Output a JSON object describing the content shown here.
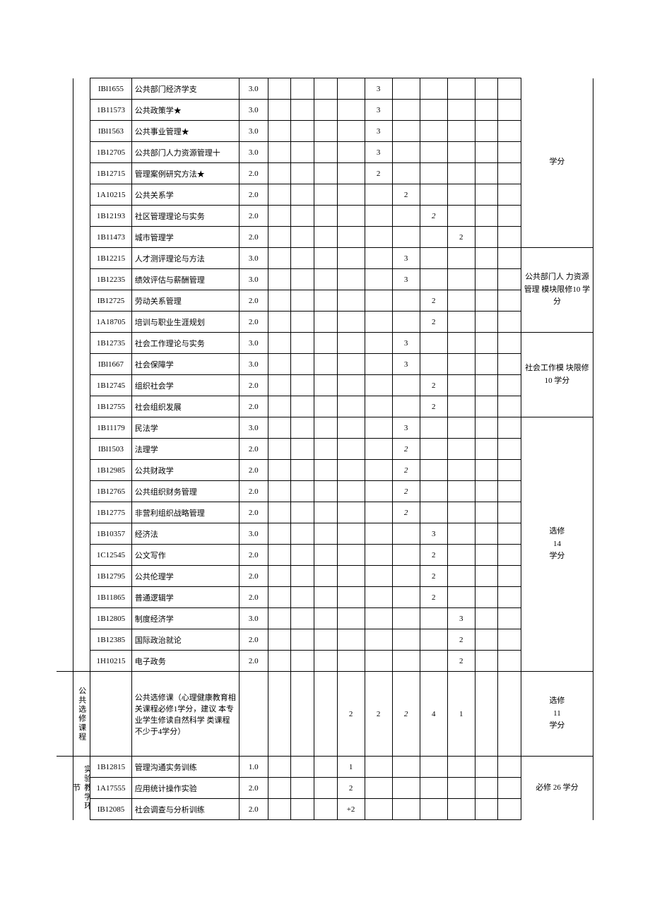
{
  "categories": {
    "public_elective": "公共选修课程",
    "experiment": "实验教学环节"
  },
  "notes_groups": {
    "g1": "学分",
    "g2": "公共部门人 力资源管理 模块限修10 学分",
    "g3": "社会工作模 块限修10 学分",
    "g4": "选修\n14\n学分",
    "g5": "选修\n11\n学分",
    "g6": "必修 26 学分"
  },
  "public_elective_note": "公共选修课（心理健康教育相关课程必修1学分，建议 本专业学生修读自然科学 类课程不少于4学分）",
  "rows": [
    {
      "code": "IBl1655",
      "name": "公共部门经济学支",
      "credit": "3.0",
      "s": {
        "5": "3"
      }
    },
    {
      "code": "1B11573",
      "name": "公共政策学★",
      "credit": "3.0",
      "s": {
        "5": "3"
      }
    },
    {
      "code": "IBl1563",
      "name": "公共事业管理★",
      "credit": "3.0",
      "s": {
        "5": "3"
      }
    },
    {
      "code": "1B12705",
      "name": "公共部门人力资源管理十",
      "credit": "3.0",
      "s": {
        "5": "3"
      }
    },
    {
      "code": "1B12715",
      "name": "管理案例研究方法★",
      "credit": "2.0",
      "s": {
        "5": "2"
      }
    },
    {
      "code": "1A10215",
      "name": "公共关系学",
      "credit": "2.0",
      "s": {
        "6": "2"
      }
    },
    {
      "code": "1B12193",
      "name": "社区管理理论与实务",
      "credit": "2.0",
      "s": {
        "7": "2",
        "7_italic": true
      }
    },
    {
      "code": "1B11473",
      "name": "城市管理学",
      "credit": "2.0",
      "s": {
        "8": "2"
      }
    },
    {
      "code": "1B12215",
      "name": "人才测评理论与方法",
      "credit": "3.0",
      "s": {
        "6": "3"
      }
    },
    {
      "code": "1B12235",
      "name": "绩效评估与薪酬管理",
      "credit": "3.0",
      "s": {
        "6": "3"
      }
    },
    {
      "code": "IB12725",
      "name": "劳动关系管理",
      "credit": "2.0",
      "s": {
        "7": "2"
      }
    },
    {
      "code": "1A18705",
      "name": "培训与职业生涯规划",
      "credit": "2.0",
      "s": {
        "7": "2"
      }
    },
    {
      "code": "1B12735",
      "name": "社会工作理论与实务",
      "credit": "3.0",
      "s": {
        "6": "3"
      }
    },
    {
      "code": "IBl1667",
      "name": "社会保障学",
      "credit": "3.0",
      "s": {
        "6": "3"
      }
    },
    {
      "code": "1B12745",
      "name": "组织社会学",
      "credit": "2.0",
      "s": {
        "7": "2"
      }
    },
    {
      "code": "1B12755",
      "name": "社会组织发展",
      "credit": "2.0",
      "s": {
        "7": "2"
      }
    },
    {
      "code": "1B11179",
      "name": "民法学",
      "credit": "3.0",
      "s": {
        "6": "3"
      }
    },
    {
      "code": "IBl1503",
      "name": "法理学",
      "credit": "2.0",
      "s": {
        "6": "2",
        "6_italic": true
      }
    },
    {
      "code": "1B12985",
      "name": "公共财政学",
      "credit": "2.0",
      "s": {
        "6": "2",
        "6_italic": true
      }
    },
    {
      "code": "1B12765",
      "name": "公共组织财务管理",
      "credit": "2.0",
      "s": {
        "6": "2",
        "6_italic": true
      }
    },
    {
      "code": "1B12775",
      "name": "非营利组织战略管理",
      "credit": "2.0",
      "s": {
        "6": "2",
        "6_italic": true
      }
    },
    {
      "code": "1B10357",
      "name": "经济法",
      "credit": "3.0",
      "s": {
        "7": "3"
      }
    },
    {
      "code": "1C12545",
      "name": "公文写作",
      "credit": "2.0",
      "s": {
        "7": "2"
      }
    },
    {
      "code": "1B12795",
      "name": "公共伦理学",
      "credit": "2.0",
      "s": {
        "7": "2"
      }
    },
    {
      "code": "1B11865",
      "name": "普通逻辑学",
      "credit": "2.0",
      "s": {
        "7": "2"
      }
    },
    {
      "code": "1B12805",
      "name": "制度经济学",
      "credit": "3.0",
      "s": {
        "8": "3"
      }
    },
    {
      "code": "1B12385",
      "name": "国际政治就论",
      "credit": "2.0",
      "s": {
        "8": "2"
      }
    },
    {
      "code": "1H10215",
      "name": "电子政务",
      "credit": "2.0",
      "s": {
        "8": "2"
      }
    }
  ],
  "public_elective_row": {
    "s": {
      "4": "2",
      "5": "2",
      "6": "2",
      "6_italic": true,
      "7": "4",
      "8": "1"
    }
  },
  "experiment_rows": [
    {
      "code": "1B12815",
      "name": "管理沟通实务训练",
      "credit": "1.0",
      "s": {
        "4": "1"
      }
    },
    {
      "code": "1A17555",
      "name": "应用统计操作实验",
      "credit": "2.0",
      "s": {
        "4": "2"
      }
    },
    {
      "code": "IB12085",
      "name": "社会调查与分析训练",
      "credit": "2.0",
      "s": {
        "4": "+2"
      }
    }
  ]
}
